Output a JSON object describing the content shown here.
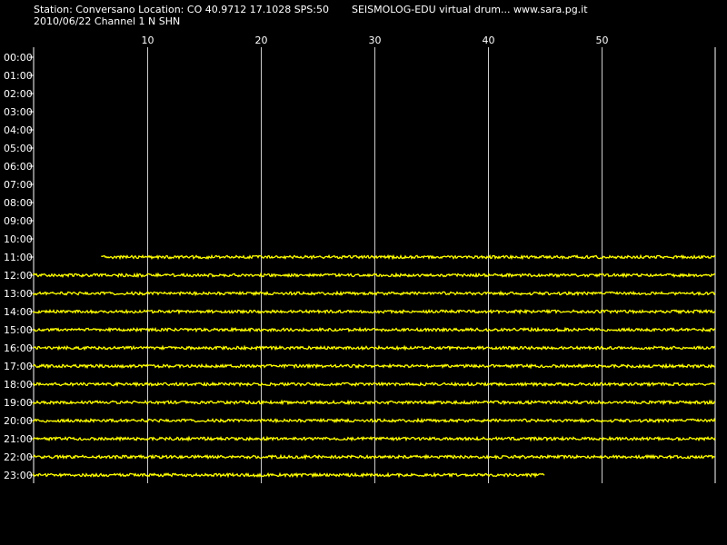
{
  "header": {
    "station_line": "Station: Conversano Location: CO 40.9712 17.1028 SPS:50",
    "date_channel_line": "2010/06/22  Channel 1 N SHN",
    "brand_line": "SEISMOLOG-EDU virtual drum... www.sara.pg.it"
  },
  "colors": {
    "background": "#000000",
    "trace": "#ffff00",
    "grid": "#ffffff",
    "text": "#ffffff"
  },
  "chart_data": {
    "type": "line",
    "title": "",
    "xlabel": "",
    "ylabel": "",
    "xlim": [
      0,
      60
    ],
    "x_ticks": [
      10,
      20,
      30,
      40,
      50
    ],
    "x_tick_labels": [
      "10",
      "20",
      "30",
      "40",
      "50"
    ],
    "grid": true,
    "rows": [
      {
        "label": "00:00",
        "start_min": null,
        "end_min": null
      },
      {
        "label": "01:00",
        "start_min": null,
        "end_min": null
      },
      {
        "label": "02:00",
        "start_min": null,
        "end_min": null
      },
      {
        "label": "03:00",
        "start_min": null,
        "end_min": null
      },
      {
        "label": "04:00",
        "start_min": null,
        "end_min": null
      },
      {
        "label": "05:00",
        "start_min": null,
        "end_min": null
      },
      {
        "label": "06:00",
        "start_min": null,
        "end_min": null
      },
      {
        "label": "07:00",
        "start_min": null,
        "end_min": null
      },
      {
        "label": "08:00",
        "start_min": null,
        "end_min": null
      },
      {
        "label": "09:00",
        "start_min": null,
        "end_min": null
      },
      {
        "label": "10:00",
        "start_min": null,
        "end_min": null
      },
      {
        "label": "11:00",
        "start_min": 6,
        "end_min": 60
      },
      {
        "label": "12:00",
        "start_min": 0,
        "end_min": 60
      },
      {
        "label": "13:00",
        "start_min": 0,
        "end_min": 60
      },
      {
        "label": "14:00",
        "start_min": 0,
        "end_min": 60
      },
      {
        "label": "15:00",
        "start_min": 0,
        "end_min": 60
      },
      {
        "label": "16:00",
        "start_min": 0,
        "end_min": 60
      },
      {
        "label": "17:00",
        "start_min": 0,
        "end_min": 60
      },
      {
        "label": "18:00",
        "start_min": 0,
        "end_min": 60
      },
      {
        "label": "19:00",
        "start_min": 0,
        "end_min": 60
      },
      {
        "label": "20:00",
        "start_min": 0,
        "end_min": 60
      },
      {
        "label": "21:00",
        "start_min": 0,
        "end_min": 60
      },
      {
        "label": "22:00",
        "start_min": 0,
        "end_min": 60
      },
      {
        "label": "23:00",
        "start_min": 0,
        "end_min": 45
      }
    ]
  }
}
